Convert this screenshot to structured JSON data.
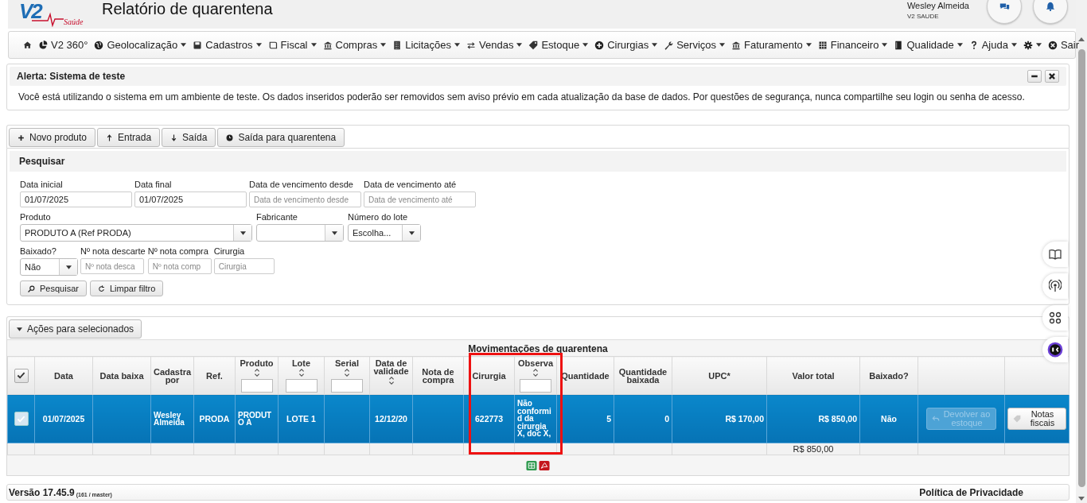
{
  "header": {
    "logo": {
      "mark": "V2",
      "tagline": "Saúde"
    },
    "title": "Relatório de quarentena",
    "user": {
      "name": "Wesley Almeida",
      "company": "V2 SAUDE"
    }
  },
  "menu": [
    {
      "dropdown": false
    },
    {
      "label": "V2 360°",
      "dropdown": false
    },
    {
      "label": "Geolocalização",
      "dropdown": true
    },
    {
      "label": "Cadastros",
      "dropdown": true
    },
    {
      "label": "Fiscal",
      "dropdown": true
    },
    {
      "label": "Compras",
      "dropdown": true
    },
    {
      "label": "Licitações",
      "dropdown": true
    },
    {
      "label": "Vendas",
      "dropdown": true
    },
    {
      "label": "Estoque",
      "dropdown": true
    },
    {
      "label": "Cirurgias",
      "dropdown": true
    },
    {
      "label": "Serviços",
      "dropdown": true
    },
    {
      "label": "Faturamento",
      "dropdown": true
    },
    {
      "label": "Financeiro",
      "dropdown": true
    },
    {
      "label": "Qualidade",
      "dropdown": true
    },
    {
      "label": "Ajuda",
      "dropdown": true
    },
    {
      "dropdown": true
    },
    {
      "label": "Sair",
      "dropdown": false
    }
  ],
  "alert": {
    "title": "Alerta: Sistema de teste",
    "message": "Você está utilizando o sistema em um ambiente de teste. Os dados inseridos poderão ser removidos sem aviso prévio em cada atualização da base de dados. Por questões de segurança, nunca compartilhe seu login ou senha de acesso."
  },
  "toolbar": [
    "Novo produto",
    "Entrada",
    "Saída",
    "Saída para quarentena"
  ],
  "search": {
    "title": "Pesquisar",
    "rows": [
      [
        {
          "kind": "text",
          "label": "Data inicial",
          "value": "01/07/2025"
        },
        {
          "kind": "text",
          "label": "Data final",
          "value": "01/07/2025"
        },
        {
          "kind": "text",
          "label": "Data de vencimento desde",
          "placeholder": "Data de vencimento desde"
        },
        {
          "kind": "text",
          "label": "Data de vencimento até",
          "placeholder": "Data de vencimento até"
        }
      ],
      [
        {
          "kind": "select",
          "label": "Produto",
          "value": "PRODUTO A (Ref PRODA)"
        },
        {
          "kind": "select",
          "label": "Fabricante"
        },
        {
          "kind": "select",
          "label": "Número do lote",
          "value": "Escolha..."
        }
      ],
      [
        {
          "kind": "select",
          "label": "Baixado?",
          "value": "Não"
        },
        {
          "kind": "text",
          "label": "Nº nota descarte",
          "placeholder": "Nº nota desca"
        },
        {
          "kind": "text",
          "label": "Nº nota compra",
          "placeholder": "Nº nota comp"
        },
        {
          "kind": "text",
          "label": "Cirurgia",
          "placeholder": "Cirurgia"
        }
      ]
    ],
    "buttons": [
      "Pesquisar",
      "Limpar filtro"
    ]
  },
  "actions_button": "Ações para selecionados",
  "table": {
    "title": "Movimentações de quarentena",
    "select_all_checked": true,
    "columns": [
      {
        "label": "Data",
        "sortable": false,
        "filter": false
      },
      {
        "label": "Data baixa",
        "sortable": false,
        "filter": false
      },
      {
        "label": "Cadastra por",
        "sortable": false,
        "filter": false
      },
      {
        "label": "Ref.",
        "sortable": false,
        "filter": false
      },
      {
        "label": "Produto",
        "sortable": true,
        "filter": true
      },
      {
        "label": "Lote",
        "sortable": true,
        "filter": true
      },
      {
        "label": "Serial",
        "sortable": true,
        "filter": true
      },
      {
        "label": "Data de validade",
        "sortable": true,
        "filter": false
      },
      {
        "label": "Nota de compra",
        "sortable": false,
        "filter": false
      },
      {
        "label": "Cirurgia",
        "sortable": false,
        "filter": false
      },
      {
        "label": "Observa",
        "sortable": true,
        "filter": true
      },
      {
        "label": "Quantidade",
        "sortable": false,
        "filter": false
      },
      {
        "label": "Quantidade baixada",
        "sortable": false,
        "filter": false
      },
      {
        "label": "UPC*",
        "sortable": false,
        "filter": false
      },
      {
        "label": "Valor total",
        "sortable": false,
        "filter": false
      },
      {
        "label": "Baixado?",
        "sortable": false,
        "filter": false
      },
      {
        "sortable": false,
        "filter": false
      },
      {
        "sortable": false,
        "filter": false
      }
    ],
    "rows": [
      {
        "selected": true,
        "checked": true,
        "date": "01/07/2025",
        "created_by": "Wesley Almeida",
        "ref": "PRODA",
        "product": "PRODUTO A",
        "lot": "LOTE 1",
        "expiry": "12/12/20",
        "surgery": "622773",
        "notes": "Não conformid da cirurgia X, doc X,",
        "quantity": "5",
        "quantity_written_off": "0",
        "upc": "R$ 170,00",
        "total_value": "R$ 850,00",
        "written_off": "Não",
        "return_button": {
          "label": "Devolver ao estoque",
          "disabled": true
        },
        "invoices_button": {
          "label": "Notas fiscais",
          "disabled": false
        }
      }
    ],
    "total_value": "R$ 850,00",
    "highlight_frame": true
  },
  "footer": {
    "version": "Versão 17.45.9",
    "build": "(161 / master)",
    "privacy": "Política de Privacidade"
  }
}
